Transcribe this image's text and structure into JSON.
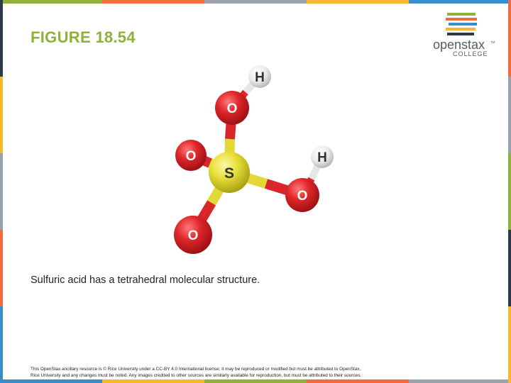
{
  "slide": {
    "title": "FIGURE 18.54",
    "caption": "Sulfuric acid has a tetrahedral molecular structure.",
    "footer_line1": "This OpenStax ancillary resource is © Rice University under a CC-BY 4.0 International license; it may be reproduced or modified but must be attributed to OpenStax,",
    "footer_line2": "Rice University and any changes must be noted. Any images credited to other sources are similarly available for reproduction, but must be attributed to their sources."
  },
  "logo": {
    "brand": "openstax",
    "trademark": "TM",
    "sub": "COLLEGE",
    "stripe_colors": [
      "#8fb13a",
      "#f26c3f",
      "#3a8dc9",
      "#f5b82e",
      "#2d3a4a"
    ]
  },
  "molecule": {
    "atoms": {
      "h_top": "H",
      "o_top": "O",
      "o_left": "O",
      "s_center": "S",
      "h_right": "H",
      "o_right": "O",
      "o_bottom": "O"
    }
  },
  "colors": {
    "title": "#8fb13a",
    "oxygen": "#e0262a",
    "sulfur": "#e8e03a",
    "hydrogen": "#f2f2f2",
    "frame": [
      "#8fb13a",
      "#f26c3f",
      "#3a8dc9",
      "#f5b82e",
      "#2d3a4a",
      "#9aa3ab"
    ]
  }
}
